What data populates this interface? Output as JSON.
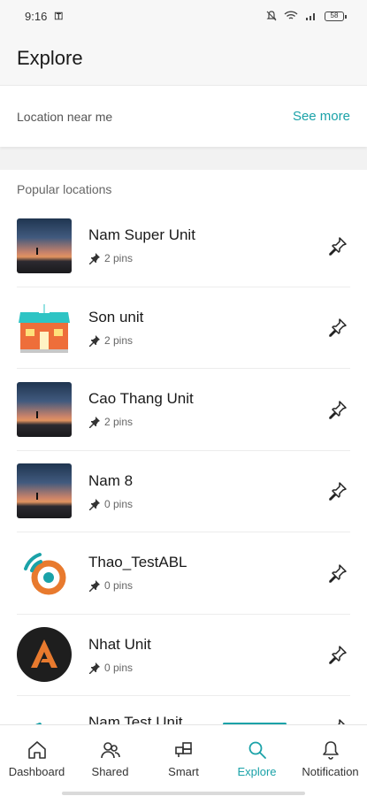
{
  "status": {
    "time": "9:16",
    "battery": "58"
  },
  "header": {
    "title": "Explore"
  },
  "near_me": {
    "label": "Location near me",
    "see_more": "See more"
  },
  "popular": {
    "title": "Popular locations",
    "items": [
      {
        "name": "Nam Super Unit",
        "pins": "2 pins",
        "thumb": "photo"
      },
      {
        "name": "Son unit",
        "pins": "2 pins",
        "thumb": "house"
      },
      {
        "name": "Cao Thang Unit",
        "pins": "2 pins",
        "thumb": "photo"
      },
      {
        "name": "Nam 8",
        "pins": "0 pins",
        "thumb": "photo"
      },
      {
        "name": "Thao_TestABL",
        "pins": "0 pins",
        "thumb": "signal-logo"
      },
      {
        "name": "Nhat Unit",
        "pins": "0 pins",
        "thumb": "a-logo"
      },
      {
        "name": "Nam Test Unit",
        "pins": "",
        "thumb": "signal-logo"
      }
    ]
  },
  "nav": {
    "dashboard": "Dashboard",
    "shared": "Shared",
    "smart": "Smart",
    "explore": "Explore",
    "notification": "Notification"
  },
  "colors": {
    "accent": "#1aa2a8",
    "orange": "#e87a2e"
  }
}
